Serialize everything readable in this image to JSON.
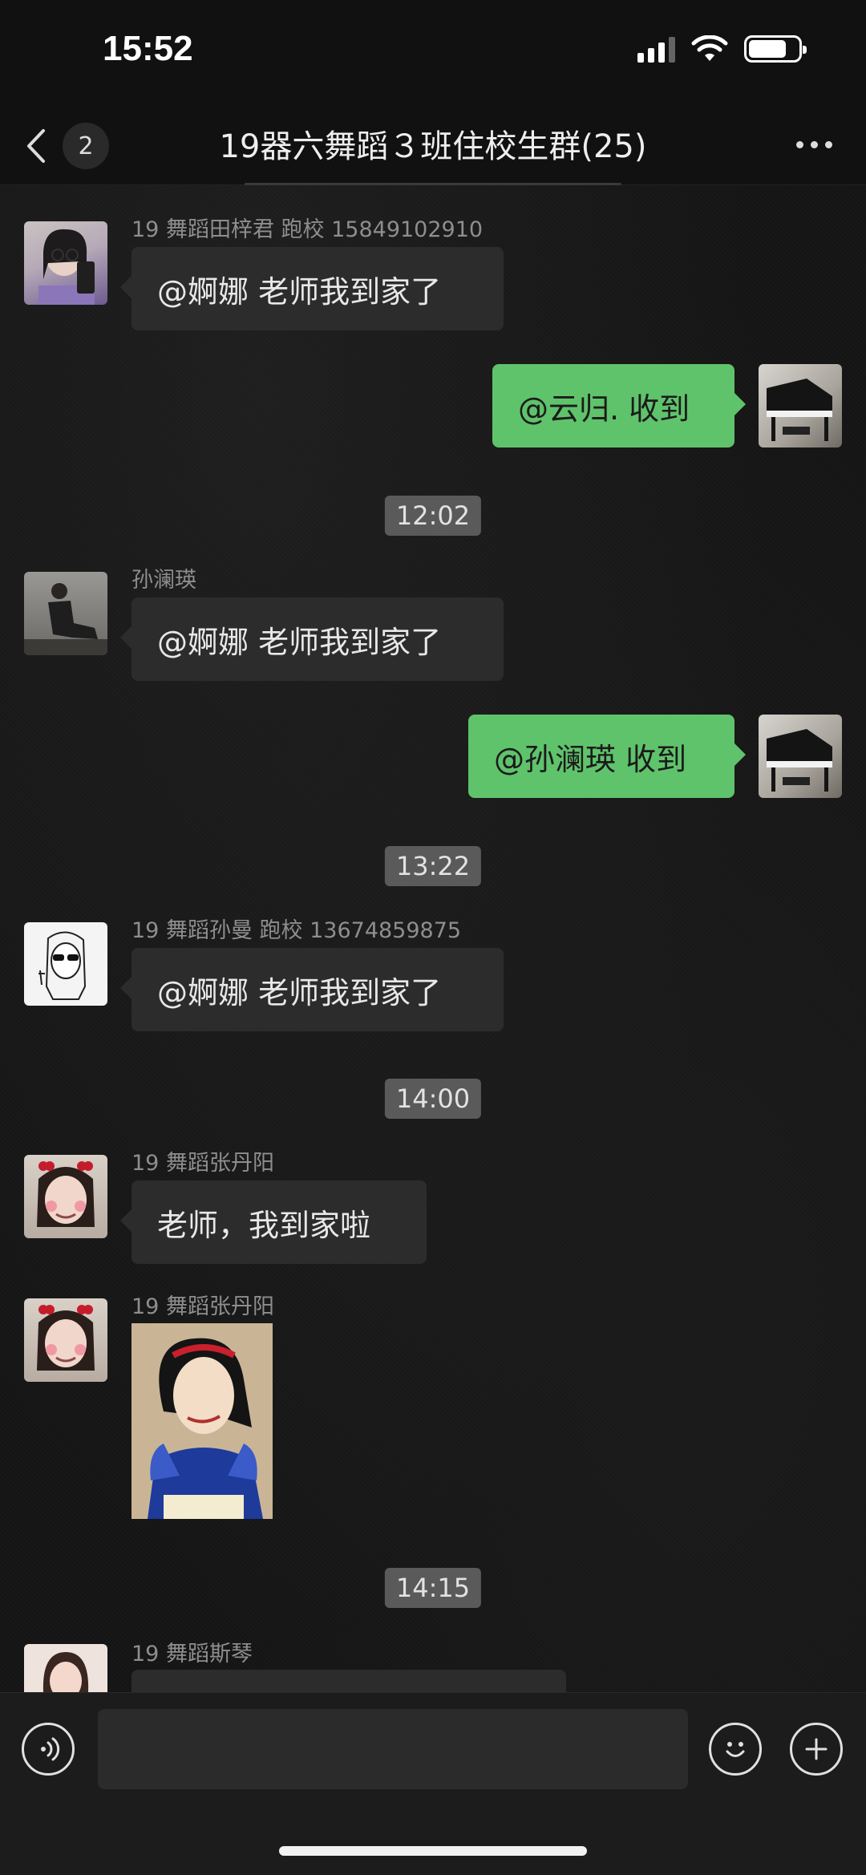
{
  "status": {
    "time": "15:52"
  },
  "nav": {
    "back_badge": "2",
    "title": "19器六舞蹈３班住校生群(25)"
  },
  "messages": [
    {
      "sender": "19 舞蹈田梓君  跑校  15849102910",
      "text": "@婀娜 老师我到家了"
    },
    {
      "text": "@云归. 收到"
    },
    {
      "timestamp": "12:02"
    },
    {
      "sender": "孙澜瑛",
      "text": "@婀娜 老师我到家了"
    },
    {
      "text": "@孙澜瑛 收到"
    },
    {
      "timestamp": "13:22"
    },
    {
      "sender": "19 舞蹈孙曼 跑校 13674859875",
      "text": "@婀娜 老师我到家了"
    },
    {
      "timestamp": "14:00"
    },
    {
      "sender": "19 舞蹈张丹阳",
      "text": "老师，我到家啦"
    },
    {
      "sender": "19 舞蹈张丹阳",
      "image": "snow-white-sticker"
    },
    {
      "timestamp": "14:15"
    },
    {
      "sender": "19 舞蹈斯琴"
    }
  ],
  "input": {
    "placeholder": ""
  },
  "colors": {
    "outgoing_bubble": "#5fc36b",
    "incoming_bubble": "#2c2c2c",
    "background": "#151515"
  }
}
